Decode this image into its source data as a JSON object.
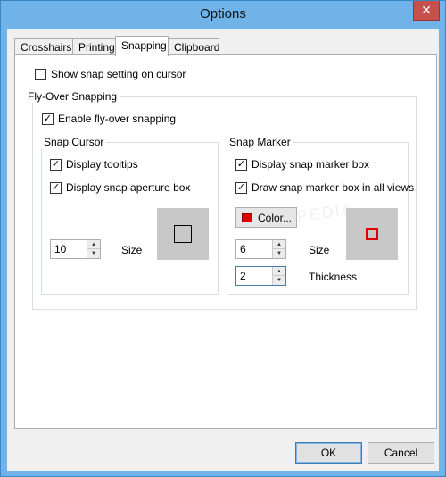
{
  "window": {
    "title": "Options",
    "close_glyph": "✕"
  },
  "tabs": [
    {
      "label": "Crosshairs"
    },
    {
      "label": "Printing"
    },
    {
      "label": "Snapping"
    },
    {
      "label": "Clipboard"
    }
  ],
  "active_tab": "Snapping",
  "snapping": {
    "show_snap_setting": {
      "label": "Show snap setting on cursor",
      "checked": false
    },
    "flyover_group": {
      "legend": "Fly-Over Snapping",
      "enable": {
        "label": "Enable fly-over snapping",
        "checked": true
      },
      "snap_cursor": {
        "legend": "Snap Cursor",
        "display_tooltips": {
          "label": "Display tooltips",
          "checked": true
        },
        "display_aperture": {
          "label": "Display snap aperture box",
          "checked": true
        },
        "size_value": "10",
        "size_label": "Size"
      },
      "snap_marker": {
        "legend": "Snap Marker",
        "display_marker_box": {
          "label": "Display snap marker box",
          "checked": true
        },
        "draw_all_views": {
          "label": "Draw snap marker box in all views",
          "checked": true
        },
        "color_button_label": "Color...",
        "marker_color": "#e00000",
        "size_value": "6",
        "size_label": "Size",
        "thickness_value": "2",
        "thickness_label": "Thickness"
      }
    }
  },
  "buttons": {
    "ok": "OK",
    "cancel": "Cancel"
  },
  "watermark": "SOFTPEDIA"
}
